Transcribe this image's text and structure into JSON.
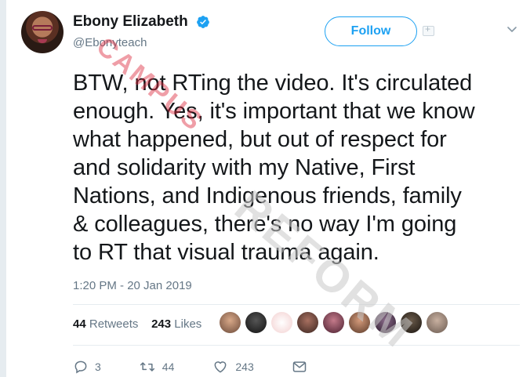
{
  "author": {
    "display_name": "Ebony Elizabeth",
    "handle": "@Ebonyteach",
    "verified": true
  },
  "follow_button": {
    "label": "Follow"
  },
  "tweet": {
    "lines": [
      "BTW, not RTing the video. It's circulated",
      "enough. Yes, it's important that we know",
      "what happened, but out of respect for",
      "and solidarity with my Native, First",
      "Nations, and Indigenous friends, family",
      "& colleagues, there's no way I'm going",
      "to RT that visual trauma again."
    ],
    "timestamp": "1:20 PM - 20 Jan 2019"
  },
  "stats": {
    "retweets_count": "44",
    "retweets_label": "Retweets",
    "likes_count": "243",
    "likes_label": "Likes"
  },
  "actions": {
    "replies": "3",
    "retweets": "44",
    "likes": "243"
  },
  "watermark": {
    "text": "CAMPUS REFORM",
    "red_part": "CAMPUS",
    "gray_part": "REFORM"
  },
  "colors": {
    "accent": "#1da1f2",
    "text": "#14171a",
    "muted": "#657786"
  },
  "icons": [
    "verified-badge-icon",
    "chevron-down-icon",
    "reply-icon",
    "retweet-icon",
    "like-icon",
    "message-icon"
  ]
}
